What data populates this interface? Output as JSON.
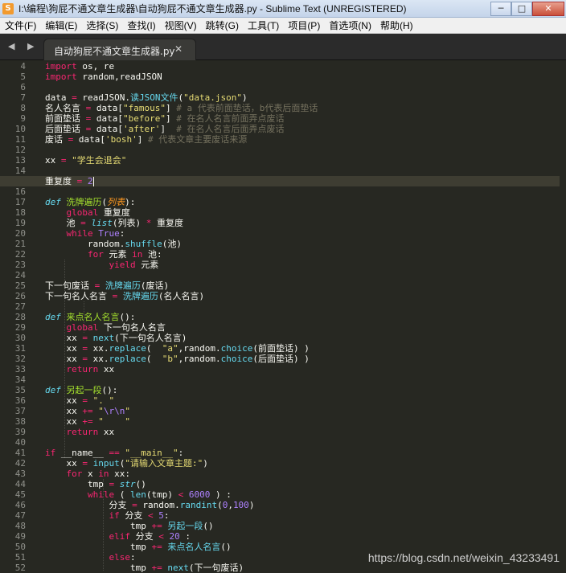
{
  "window": {
    "title": "I:\\编程\\狗屁不通文章生成器\\自动狗屁不通文章生成器.py - Sublime Text (UNREGISTERED)",
    "minimize": "─",
    "maximize": "□",
    "close": "✕"
  },
  "menu": [
    "文件(F)",
    "编辑(E)",
    "选择(S)",
    "查找(I)",
    "视图(V)",
    "跳转(G)",
    "工具(T)",
    "项目(P)",
    "首选项(N)",
    "帮助(H)"
  ],
  "nav": {
    "back_forward": "◀ ▶"
  },
  "tab": {
    "label": "自动狗屁不通文章生成器.py",
    "close": "✕"
  },
  "editor": {
    "current_line": 15,
    "line_numbers": [
      "4",
      "5",
      "6",
      "7",
      "8",
      "9",
      "10",
      "11",
      "12",
      "13",
      "14",
      "15",
      "16",
      "17",
      "18",
      "19",
      "20",
      "21",
      "22",
      "23",
      "24",
      "25",
      "26",
      "27",
      "28",
      "29",
      "30",
      "31",
      "32",
      "33",
      "34",
      "35",
      "36",
      "37",
      "38",
      "39",
      "40",
      "41",
      "42",
      "43",
      "44",
      "45",
      "46",
      "47",
      "48",
      "49",
      "50",
      "51",
      "52"
    ]
  },
  "watermark": "https://blog.csdn.net/weixin_43233491"
}
